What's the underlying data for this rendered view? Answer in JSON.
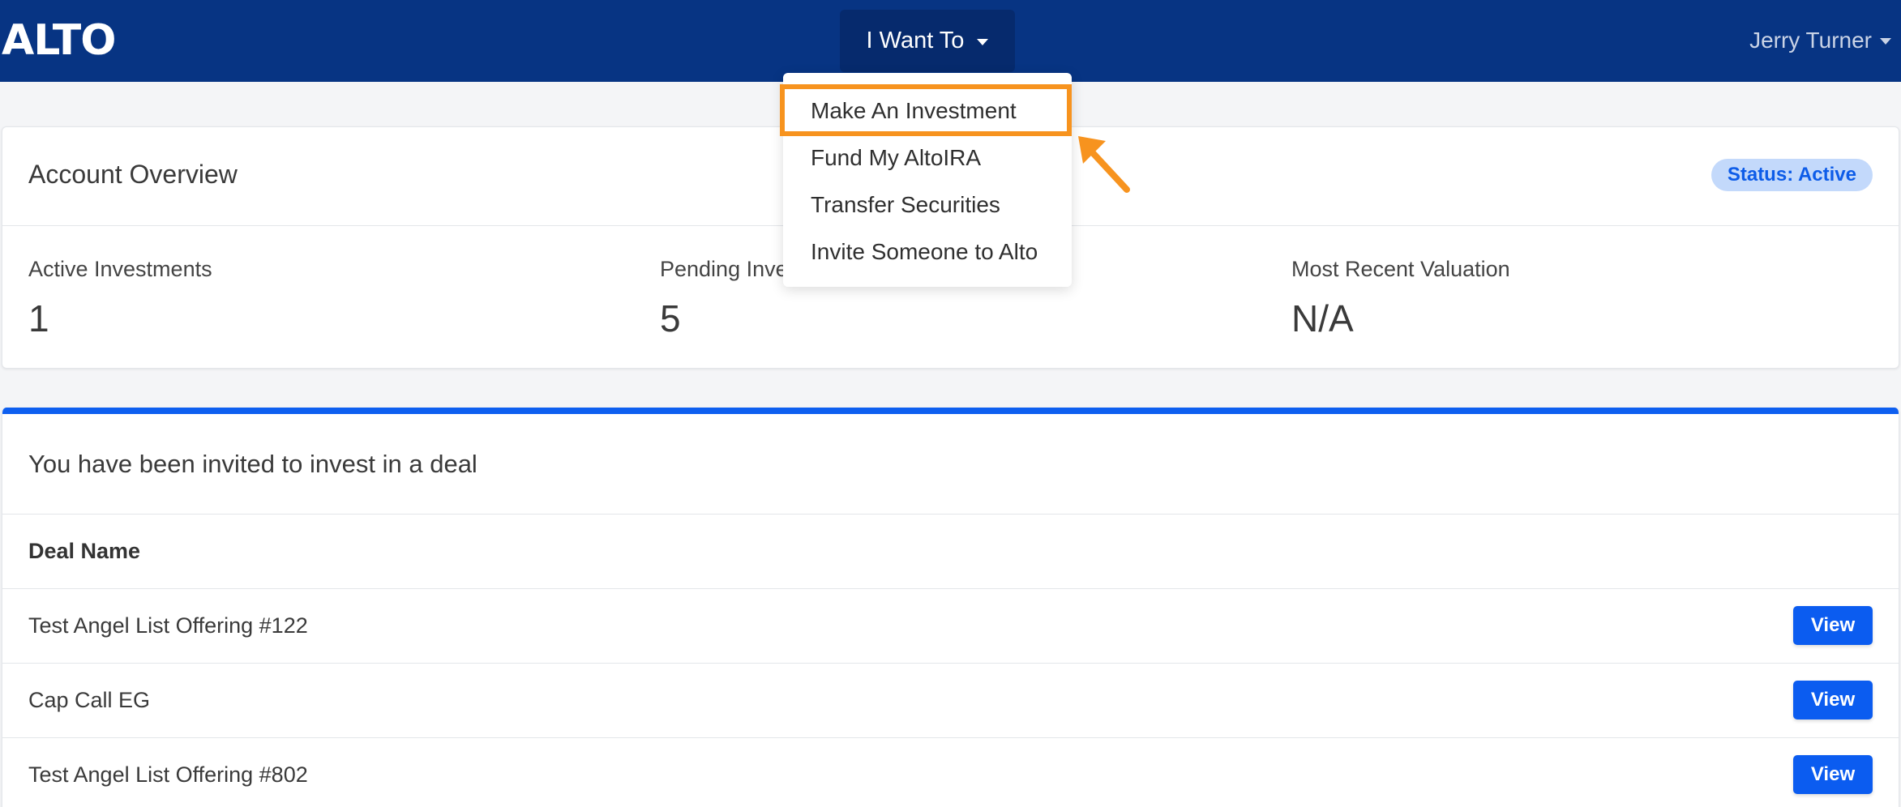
{
  "navbar": {
    "logo": "ALTO",
    "menu_button": "I Want To",
    "user_name": "Jerry Turner"
  },
  "dropdown": {
    "items": [
      "Make An Investment",
      "Fund My AltoIRA",
      "Transfer Securities",
      "Invite Someone to Alto"
    ]
  },
  "overview": {
    "title": "Account Overview",
    "status": "Status: Active",
    "stats": [
      {
        "label": "Active Investments",
        "value": "1"
      },
      {
        "label": "Pending Investments",
        "value": "5"
      },
      {
        "label": "Most Recent Valuation",
        "value": "N/A"
      }
    ]
  },
  "deals": {
    "title": "You have been invited to invest in a deal",
    "column_header": "Deal Name",
    "rows": [
      {
        "name": "Test Angel List Offering #122",
        "action": "View"
      },
      {
        "name": "Cap Call EG",
        "action": "View"
      },
      {
        "name": "Test Angel List Offering #802",
        "action": "View"
      }
    ]
  },
  "colors": {
    "navbar": "#073483",
    "accent": "#0b5cf0",
    "highlight": "#f7931e",
    "status_badge_bg": "#c3d9fb"
  },
  "icons": [
    "caret-down-icon",
    "annotation-arrow-icon"
  ]
}
